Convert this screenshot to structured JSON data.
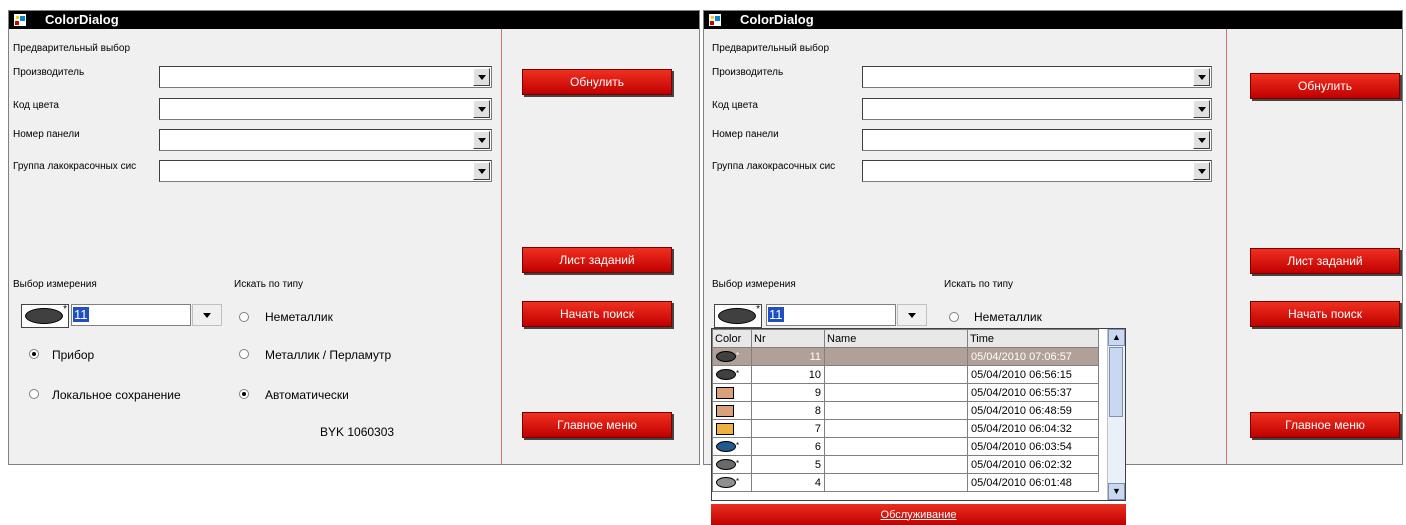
{
  "colors": {
    "button_red": "#d81e10",
    "divider": "#e07070",
    "titlebar": "#000000",
    "selected_row": "#b0a097"
  },
  "left": {
    "title": "ColorDialog",
    "preselect_label": "Предварительный выбор",
    "fields": [
      {
        "label": "Производитель",
        "value": ""
      },
      {
        "label": "Код цвета",
        "value": ""
      },
      {
        "label": "Номер панели",
        "value": ""
      },
      {
        "label": "Группа лакокрасочных сис",
        "value": ""
      }
    ],
    "measure_label": "Выбор измерения",
    "search_type_label": "Искать по типу",
    "measurement_value": "11",
    "radio_device": "Прибор",
    "radio_local": "Локальное сохранение",
    "radio_nonmetal": "Неметаллик",
    "radio_metal": "Металлик / Перламутр",
    "radio_auto": "Автоматически",
    "serial": "BYK 1060303",
    "buttons": {
      "reset": "Обнулить",
      "worklist": "Лист заданий",
      "search": "Начать поиск",
      "main_menu": "Главное меню"
    }
  },
  "right": {
    "title": "ColorDialog",
    "preselect_label": "Предварительный выбор",
    "fields": [
      {
        "label": "Производитель",
        "value": ""
      },
      {
        "label": "Код цвета",
        "value": ""
      },
      {
        "label": "Номер панели",
        "value": ""
      },
      {
        "label": "Группа лакокрасочных сис",
        "value": ""
      }
    ],
    "measure_label": "Выбор измерения",
    "search_type_label": "Искать по типу",
    "measurement_value": "11",
    "radio_nonmetal": "Неметаллик",
    "buttons": {
      "reset": "Обнулить",
      "worklist": "Лист заданий",
      "search": "Начать поиск",
      "main_menu": "Главное меню"
    },
    "history": {
      "headers": {
        "color": "Color",
        "nr": "Nr",
        "name": "Name",
        "time": "Time"
      },
      "rows": [
        {
          "swatch": "oval",
          "color": "#404040",
          "nr": "11",
          "name": "",
          "time": "05/04/2010 07:06:57"
        },
        {
          "swatch": "oval",
          "color": "#404040",
          "nr": "10",
          "name": "",
          "time": "05/04/2010 06:56:15"
        },
        {
          "swatch": "square",
          "color": "#d9a07a",
          "nr": "9",
          "name": "",
          "time": "05/04/2010 06:55:37"
        },
        {
          "swatch": "square",
          "color": "#d9a07a",
          "nr": "8",
          "name": "",
          "time": "05/04/2010 06:48:59"
        },
        {
          "swatch": "square",
          "color": "#f0b040",
          "nr": "7",
          "name": "",
          "time": "05/04/2010 06:04:32"
        },
        {
          "swatch": "oval",
          "color": "#1f5a90",
          "nr": "6",
          "name": "",
          "time": "05/04/2010 06:03:54"
        },
        {
          "swatch": "oval",
          "color": "#6a6a6a",
          "nr": "5",
          "name": "",
          "time": "05/04/2010 06:02:32"
        },
        {
          "swatch": "oval",
          "color": "#909090",
          "nr": "4",
          "name": "",
          "time": "05/04/2010 06:01:48"
        }
      ],
      "service_button": "Обслуживание"
    }
  }
}
